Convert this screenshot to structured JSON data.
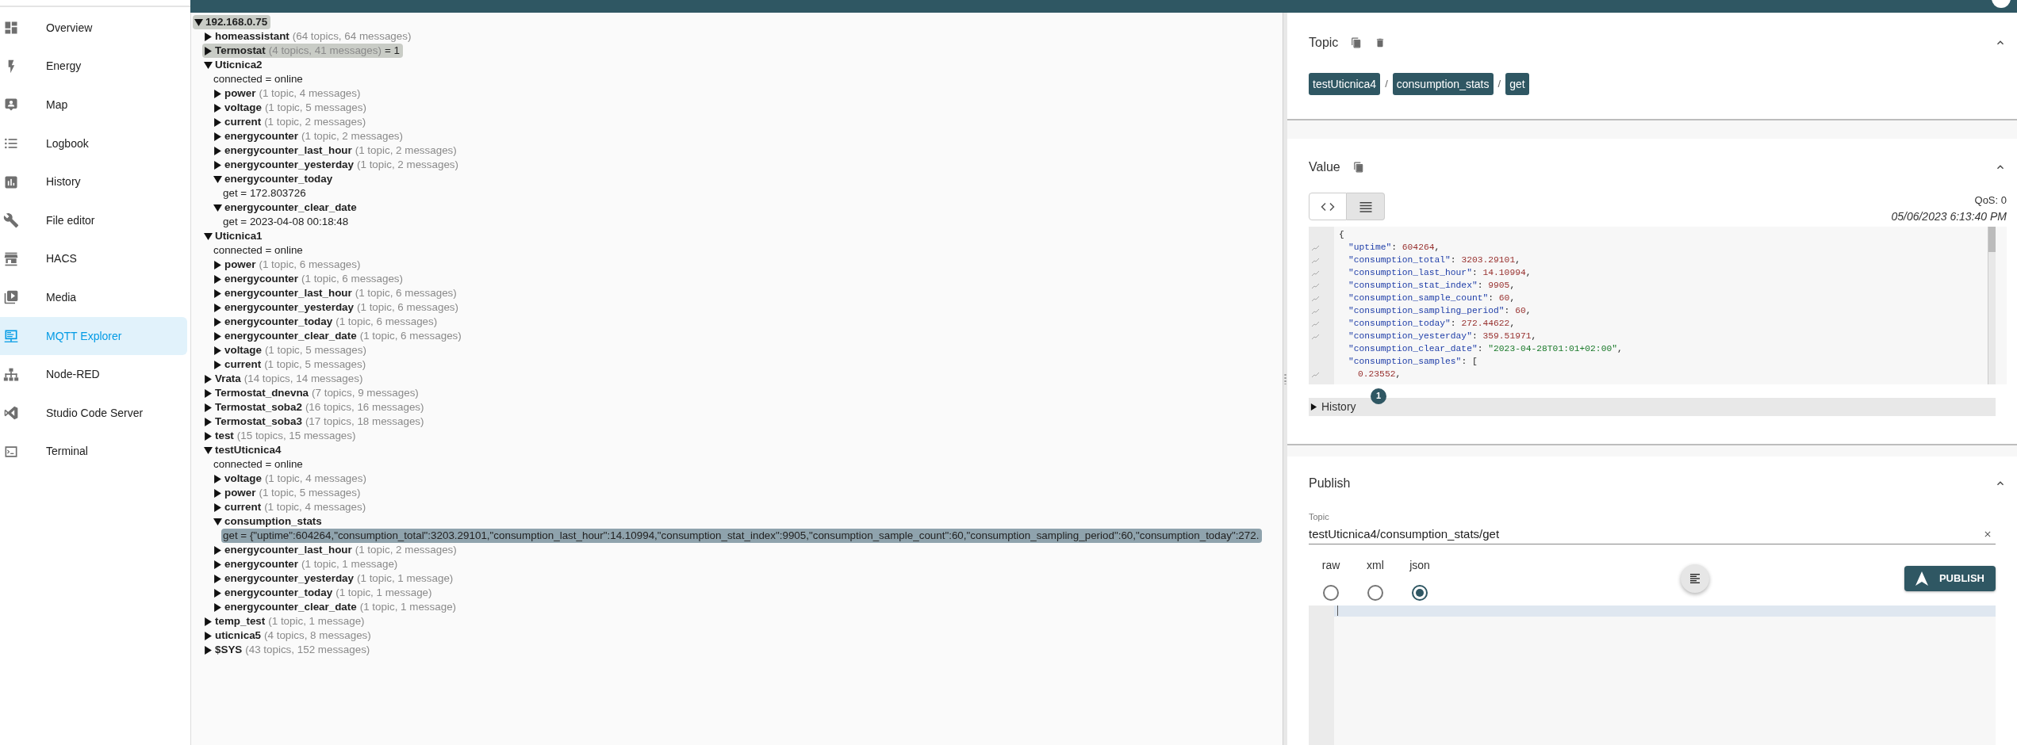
{
  "sidebar": {
    "items": [
      {
        "kind": "dashboard",
        "label": "Overview",
        "selected": false
      },
      {
        "kind": "energy",
        "label": "Energy",
        "selected": false
      },
      {
        "kind": "map",
        "label": "Map",
        "selected": false
      },
      {
        "kind": "logbook",
        "label": "Logbook",
        "selected": false
      },
      {
        "kind": "history",
        "label": "History",
        "selected": false
      },
      {
        "kind": "editor",
        "label": "File editor",
        "selected": false
      },
      {
        "kind": "store",
        "label": "HACS",
        "selected": false
      },
      {
        "kind": "media",
        "label": "Media",
        "selected": false
      },
      {
        "kind": "monitor",
        "label": "MQTT Explorer",
        "selected": true
      },
      {
        "kind": "sitemap",
        "label": "Node-RED",
        "selected": false
      },
      {
        "kind": "code",
        "label": "Studio Code Server",
        "selected": false
      },
      {
        "kind": "terminal",
        "label": "Terminal",
        "selected": false
      }
    ]
  },
  "tree": {
    "name": "192.168.0.75",
    "expanded": true,
    "highlighted": true,
    "selected": false,
    "children": [
      {
        "name": "homeassistant",
        "summary": "(64 topics, 64 messages)",
        "expanded": false,
        "highlighted": false,
        "selected": false
      },
      {
        "name": "Termostat",
        "summary": "(4 topics, 41 messages)",
        "value": "= 1",
        "expanded": false,
        "highlighted": true,
        "selected": false
      },
      {
        "name": "Uticnica2",
        "expanded": true,
        "highlighted": false,
        "selected": false,
        "children": [
          {
            "text": "connected = online",
            "highlighted": false,
            "selected": false
          },
          {
            "name": "power",
            "summary": "(1 topic, 4 messages)",
            "expanded": false,
            "highlighted": false,
            "selected": false
          },
          {
            "name": "voltage",
            "summary": "(1 topic, 5 messages)",
            "expanded": false,
            "highlighted": false,
            "selected": false
          },
          {
            "name": "current",
            "summary": "(1 topic, 2 messages)",
            "expanded": false,
            "highlighted": false,
            "selected": false
          },
          {
            "name": "energycounter",
            "summary": "(1 topic, 2 messages)",
            "expanded": false,
            "highlighted": false,
            "selected": false
          },
          {
            "name": "energycounter_last_hour",
            "summary": "(1 topic, 2 messages)",
            "expanded": false,
            "highlighted": false,
            "selected": false
          },
          {
            "name": "energycounter_yesterday",
            "summary": "(1 topic, 2 messages)",
            "expanded": false,
            "highlighted": false,
            "selected": false
          },
          {
            "name": "energycounter_today",
            "expanded": true,
            "highlighted": false,
            "selected": false,
            "children": [
              {
                "text": "get = 172.803726",
                "highlighted": false,
                "selected": false
              }
            ]
          },
          {
            "name": "energycounter_clear_date",
            "expanded": true,
            "highlighted": false,
            "selected": false,
            "children": [
              {
                "text": "get = 2023-04-08 00:18:48",
                "highlighted": false,
                "selected": false
              }
            ]
          }
        ]
      },
      {
        "name": "Uticnica1",
        "expanded": true,
        "highlighted": false,
        "selected": false,
        "children": [
          {
            "text": "connected = online",
            "highlighted": false,
            "selected": false
          },
          {
            "name": "power",
            "summary": "(1 topic, 6 messages)",
            "expanded": false,
            "highlighted": false,
            "selected": false
          },
          {
            "name": "energycounter",
            "summary": "(1 topic, 6 messages)",
            "expanded": false,
            "highlighted": false,
            "selected": false
          },
          {
            "name": "energycounter_last_hour",
            "summary": "(1 topic, 6 messages)",
            "expanded": false,
            "highlighted": false,
            "selected": false
          },
          {
            "name": "energycounter_yesterday",
            "summary": "(1 topic, 6 messages)",
            "expanded": false,
            "highlighted": false,
            "selected": false
          },
          {
            "name": "energycounter_today",
            "summary": "(1 topic, 6 messages)",
            "expanded": false,
            "highlighted": false,
            "selected": false
          },
          {
            "name": "energycounter_clear_date",
            "summary": "(1 topic, 6 messages)",
            "expanded": false,
            "highlighted": false,
            "selected": false
          },
          {
            "name": "voltage",
            "summary": "(1 topic, 5 messages)",
            "expanded": false,
            "highlighted": false,
            "selected": false
          },
          {
            "name": "current",
            "summary": "(1 topic, 5 messages)",
            "expanded": false,
            "highlighted": false,
            "selected": false
          }
        ]
      },
      {
        "name": "Vrata",
        "summary": "(14 topics, 14 messages)",
        "expanded": false,
        "highlighted": false,
        "selected": false
      },
      {
        "name": "Termostat_dnevna",
        "summary": "(7 topics, 9 messages)",
        "expanded": false,
        "highlighted": false,
        "selected": false
      },
      {
        "name": "Termostat_soba2",
        "summary": "(16 topics, 16 messages)",
        "expanded": false,
        "highlighted": false,
        "selected": false
      },
      {
        "name": "Termostat_soba3",
        "summary": "(17 topics, 18 messages)",
        "expanded": false,
        "highlighted": false,
        "selected": false
      },
      {
        "name": "test",
        "summary": "(15 topics, 15 messages)",
        "expanded": false,
        "highlighted": false,
        "selected": false
      },
      {
        "name": "testUticnica4",
        "expanded": true,
        "highlighted": false,
        "selected": false,
        "children": [
          {
            "text": "connected = online",
            "highlighted": false,
            "selected": false
          },
          {
            "name": "voltage",
            "summary": "(1 topic, 4 messages)",
            "expanded": false,
            "highlighted": false,
            "selected": false
          },
          {
            "name": "power",
            "summary": "(1 topic, 5 messages)",
            "expanded": false,
            "highlighted": false,
            "selected": false
          },
          {
            "name": "current",
            "summary": "(1 topic, 4 messages)",
            "expanded": false,
            "highlighted": false,
            "selected": false
          },
          {
            "name": "consumption_stats",
            "expanded": true,
            "highlighted": false,
            "selected": false,
            "children": [
              {
                "text": "get = {\"uptime\":604264,\"consumption_total\":3203.29101,\"consumption_last_hour\":14.10994,\"consumption_stat_index\":9905,\"consumption_sample_count\":60,\"consumption_sampling_period\":60,\"consumption_today\":272.",
                "highlighted": false,
                "selected": true
              }
            ]
          },
          {
            "name": "energycounter_last_hour",
            "summary": "(1 topic, 2 messages)",
            "expanded": false,
            "highlighted": false,
            "selected": false
          },
          {
            "name": "energycounter",
            "summary": "(1 topic, 1 message)",
            "expanded": false,
            "highlighted": false,
            "selected": false
          },
          {
            "name": "energycounter_yesterday",
            "summary": "(1 topic, 1 message)",
            "expanded": false,
            "highlighted": false,
            "selected": false
          },
          {
            "name": "energycounter_today",
            "summary": "(1 topic, 1 message)",
            "expanded": false,
            "highlighted": false,
            "selected": false
          },
          {
            "name": "energycounter_clear_date",
            "summary": "(1 topic, 1 message)",
            "expanded": false,
            "highlighted": false,
            "selected": false
          }
        ]
      },
      {
        "name": "temp_test",
        "summary": "(1 topic, 1 message)",
        "expanded": false,
        "highlighted": false,
        "selected": false
      },
      {
        "name": "uticnica5",
        "summary": "(4 topics, 8 messages)",
        "expanded": false,
        "highlighted": false,
        "selected": false
      },
      {
        "name": "$SYS",
        "summary": "(43 topics, 152 messages)",
        "expanded": false,
        "highlighted": false,
        "selected": false
      }
    ]
  },
  "topic": {
    "title": "Topic",
    "path": [
      "testUticnica4",
      "consumption_stats",
      "get"
    ],
    "separator": "/",
    "expanded": true
  },
  "value": {
    "title": "Value",
    "expanded": true,
    "views": [
      {
        "kind": "code",
        "selected": false
      },
      {
        "kind": "list",
        "selected": true
      }
    ],
    "qos": "QoS: 0",
    "timestamp": "05/06/2023 6:13:40 PM",
    "lines": [
      {
        "kind": "brace",
        "spark": false,
        "segments": [
          {
            "text": "{",
            "kind": "punct"
          }
        ]
      },
      {
        "kind": "entry",
        "spark": true,
        "segments": [
          {
            "text": "\"uptime\"",
            "kind": "key"
          },
          {
            "text": ": ",
            "kind": "punct"
          },
          {
            "text": "604264",
            "kind": "number"
          },
          {
            "text": ",",
            "kind": "punct"
          }
        ]
      },
      {
        "kind": "entry",
        "spark": true,
        "segments": [
          {
            "text": "\"consumption_total\"",
            "kind": "key"
          },
          {
            "text": ": ",
            "kind": "punct"
          },
          {
            "text": "3203.29101",
            "kind": "number"
          },
          {
            "text": ",",
            "kind": "punct"
          }
        ]
      },
      {
        "kind": "entry",
        "spark": true,
        "segments": [
          {
            "text": "\"consumption_last_hour\"",
            "kind": "key"
          },
          {
            "text": ": ",
            "kind": "punct"
          },
          {
            "text": "14.10994",
            "kind": "number"
          },
          {
            "text": ",",
            "kind": "punct"
          }
        ]
      },
      {
        "kind": "entry",
        "spark": true,
        "segments": [
          {
            "text": "\"consumption_stat_index\"",
            "kind": "key"
          },
          {
            "text": ": ",
            "kind": "punct"
          },
          {
            "text": "9905",
            "kind": "number"
          },
          {
            "text": ",",
            "kind": "punct"
          }
        ]
      },
      {
        "kind": "entry",
        "spark": true,
        "segments": [
          {
            "text": "\"consumption_sample_count\"",
            "kind": "key"
          },
          {
            "text": ": ",
            "kind": "punct"
          },
          {
            "text": "60",
            "kind": "number"
          },
          {
            "text": ",",
            "kind": "punct"
          }
        ]
      },
      {
        "kind": "entry",
        "spark": true,
        "segments": [
          {
            "text": "\"consumption_sampling_period\"",
            "kind": "key"
          },
          {
            "text": ": ",
            "kind": "punct"
          },
          {
            "text": "60",
            "kind": "number"
          },
          {
            "text": ",",
            "kind": "punct"
          }
        ]
      },
      {
        "kind": "entry",
        "spark": true,
        "segments": [
          {
            "text": "\"consumption_today\"",
            "kind": "key"
          },
          {
            "text": ": ",
            "kind": "punct"
          },
          {
            "text": "272.44622",
            "kind": "number"
          },
          {
            "text": ",",
            "kind": "punct"
          }
        ]
      },
      {
        "kind": "entry",
        "spark": true,
        "segments": [
          {
            "text": "\"consumption_yesterday\"",
            "kind": "key"
          },
          {
            "text": ": ",
            "kind": "punct"
          },
          {
            "text": "359.51971",
            "kind": "number"
          },
          {
            "text": ",",
            "kind": "punct"
          }
        ]
      },
      {
        "kind": "entry",
        "spark": false,
        "segments": [
          {
            "text": "\"consumption_clear_date\"",
            "kind": "key"
          },
          {
            "text": ": ",
            "kind": "punct"
          },
          {
            "text": "\"2023-04-28T01:01+02:00\"",
            "kind": "string"
          },
          {
            "text": ",",
            "kind": "punct"
          }
        ]
      },
      {
        "kind": "entry",
        "spark": false,
        "segments": [
          {
            "text": "\"consumption_samples\"",
            "kind": "key"
          },
          {
            "text": ": [",
            "kind": "punct"
          }
        ]
      },
      {
        "kind": "item",
        "spark": true,
        "segments": [
          {
            "text": "0.23552",
            "kind": "number"
          },
          {
            "text": ",",
            "kind": "punct"
          }
        ]
      }
    ],
    "history": {
      "label": "History",
      "count": "1",
      "expanded": false
    }
  },
  "publish": {
    "title": "Publish",
    "expanded": true,
    "topic_label": "Topic",
    "topic": "testUticnica4/consumption_stats/get",
    "formats": [
      {
        "label": "raw",
        "selected": false
      },
      {
        "label": "xml",
        "selected": false
      },
      {
        "label": "json",
        "selected": true
      }
    ],
    "button": "PUBLISH"
  }
}
